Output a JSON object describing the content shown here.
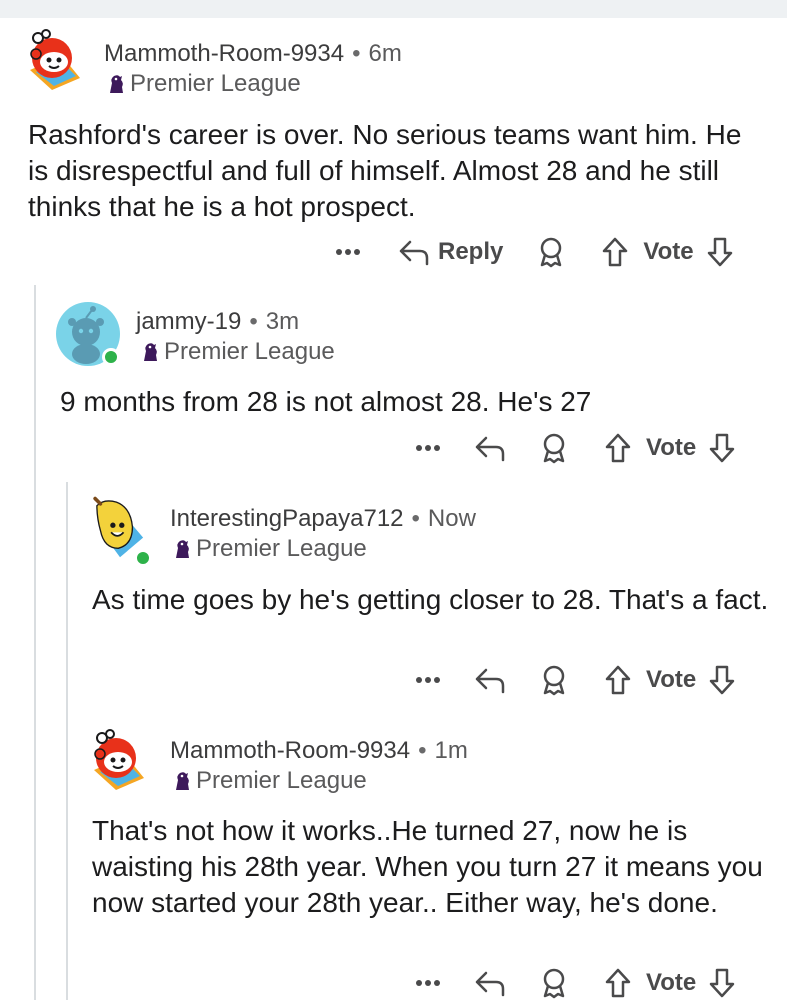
{
  "comments": [
    {
      "username": "Mammoth-Room-9934",
      "time": "6m",
      "flair": "Premier League",
      "body": "Rashford's career is over. No serious teams want him. He is disrespectful and full of himself. Almost 28 and he still thinks that he is a hot prospect.",
      "reply_label": "Reply",
      "vote_label": "Vote"
    },
    {
      "username": "jammy-19",
      "time": "3m",
      "flair": "Premier League",
      "body": "9 months from 28 is not almost 28. He's 27",
      "vote_label": "Vote"
    },
    {
      "username": "InterestingPapaya712",
      "time": "Now",
      "flair": "Premier League",
      "body": "As time goes by he's getting closer to 28. That's a fact.",
      "vote_label": "Vote"
    },
    {
      "username": "Mammoth-Room-9934",
      "time": "1m",
      "flair": "Premier League",
      "body": "That's not how it works..He turned 27, now he is waisting his 28th year. When you turn 27 it means you now started your 28th year.. Either way, he's done.",
      "vote_label": "Vote"
    }
  ],
  "separator": "•",
  "colors": {
    "online": "#2eb24a",
    "thread": "#d9dde0",
    "flair_icon": "#3d195b"
  }
}
